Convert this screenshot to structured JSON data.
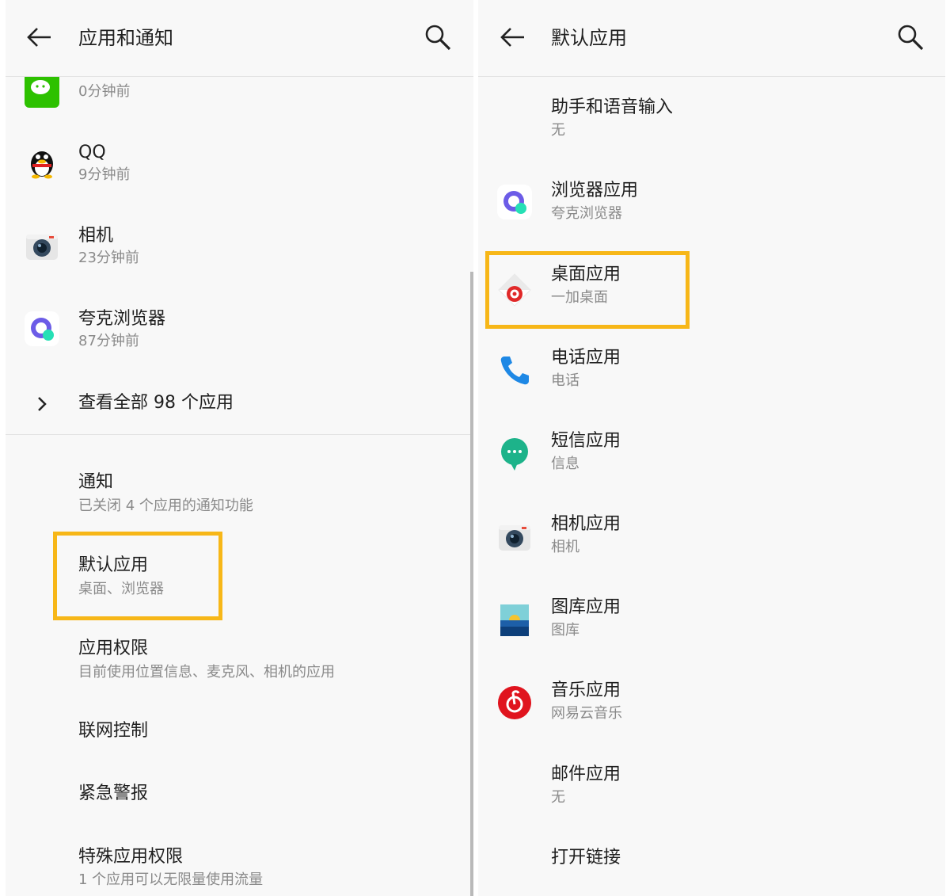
{
  "left": {
    "title": "应用和通知",
    "recent_apps": [
      {
        "name": "微信",
        "time": "0分钟前",
        "icon": "wechat-icon"
      },
      {
        "name": "QQ",
        "time": "9分钟前",
        "icon": "qq-icon"
      },
      {
        "name": "相机",
        "time": "23分钟前",
        "icon": "camera-icon"
      },
      {
        "name": "夸克浏览器",
        "time": "87分钟前",
        "icon": "quark-browser-icon"
      }
    ],
    "see_all": "查看全部 98 个应用",
    "settings": [
      {
        "label": "通知",
        "sub": "已关闭 4 个应用的通知功能"
      },
      {
        "label": "默认应用",
        "sub": "桌面、浏览器"
      },
      {
        "label": "应用权限",
        "sub": "目前使用位置信息、麦克风、相机的应用"
      },
      {
        "label": "联网控制",
        "sub": ""
      },
      {
        "label": "紧急警报",
        "sub": ""
      },
      {
        "label": "特殊应用权限",
        "sub": "1 个应用可以无限量使用流量"
      }
    ]
  },
  "right": {
    "title": "默认应用",
    "items": [
      {
        "label": "助手和语音输入",
        "sub": "无",
        "icon": ""
      },
      {
        "label": "浏览器应用",
        "sub": "夸克浏览器",
        "icon": "quark-browser-icon"
      },
      {
        "label": "桌面应用",
        "sub": "一加桌面",
        "icon": "oneplus-launcher-icon"
      },
      {
        "label": "电话应用",
        "sub": "电话",
        "icon": "phone-icon"
      },
      {
        "label": "短信应用",
        "sub": "信息",
        "icon": "messages-icon"
      },
      {
        "label": "相机应用",
        "sub": "相机",
        "icon": "camera-icon"
      },
      {
        "label": "图库应用",
        "sub": "图库",
        "icon": "gallery-icon"
      },
      {
        "label": "音乐应用",
        "sub": "网易云音乐",
        "icon": "netease-music-icon"
      },
      {
        "label": "邮件应用",
        "sub": "无",
        "icon": ""
      },
      {
        "label": "打开链接",
        "sub": "",
        "icon": ""
      }
    ]
  },
  "colors": {
    "highlight": "#f7b718",
    "background": "#f8f8f8",
    "subtext": "#8a8a8a"
  }
}
